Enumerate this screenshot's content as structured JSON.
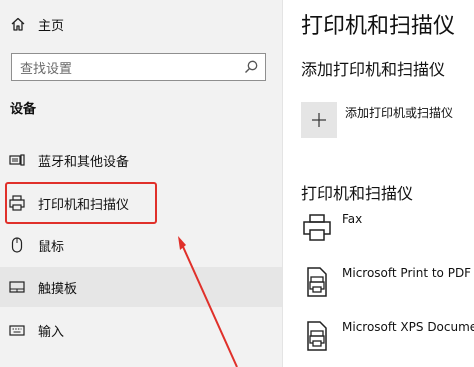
{
  "sidebar": {
    "home_label": "主页",
    "search_placeholder": "查找设置",
    "section_label": "设备",
    "items": [
      {
        "label": "蓝牙和其他设备",
        "icon": "bluetooth-devices-icon"
      },
      {
        "label": "打印机和扫描仪",
        "icon": "printer-icon"
      },
      {
        "label": "鼠标",
        "icon": "mouse-icon"
      },
      {
        "label": "触摸板",
        "icon": "touchpad-icon"
      },
      {
        "label": "输入",
        "icon": "keyboard-icon"
      }
    ]
  },
  "main": {
    "title": "打印机和扫描仪",
    "add_section_title": "添加打印机和扫描仪",
    "add_button_label": "添加打印机或扫描仪",
    "list_title": "打印机和扫描仪",
    "devices": [
      {
        "name": "Fax",
        "icon": "fax-icon"
      },
      {
        "name": "Microsoft Print to PDF",
        "icon": "printer-document-icon"
      },
      {
        "name": "Microsoft XPS Document Writer",
        "icon": "printer-document-icon"
      }
    ]
  },
  "colors": {
    "highlight": "#e0302a",
    "sidebar_bg": "#f2f2f2",
    "hover_bg": "#e6e6e6"
  }
}
